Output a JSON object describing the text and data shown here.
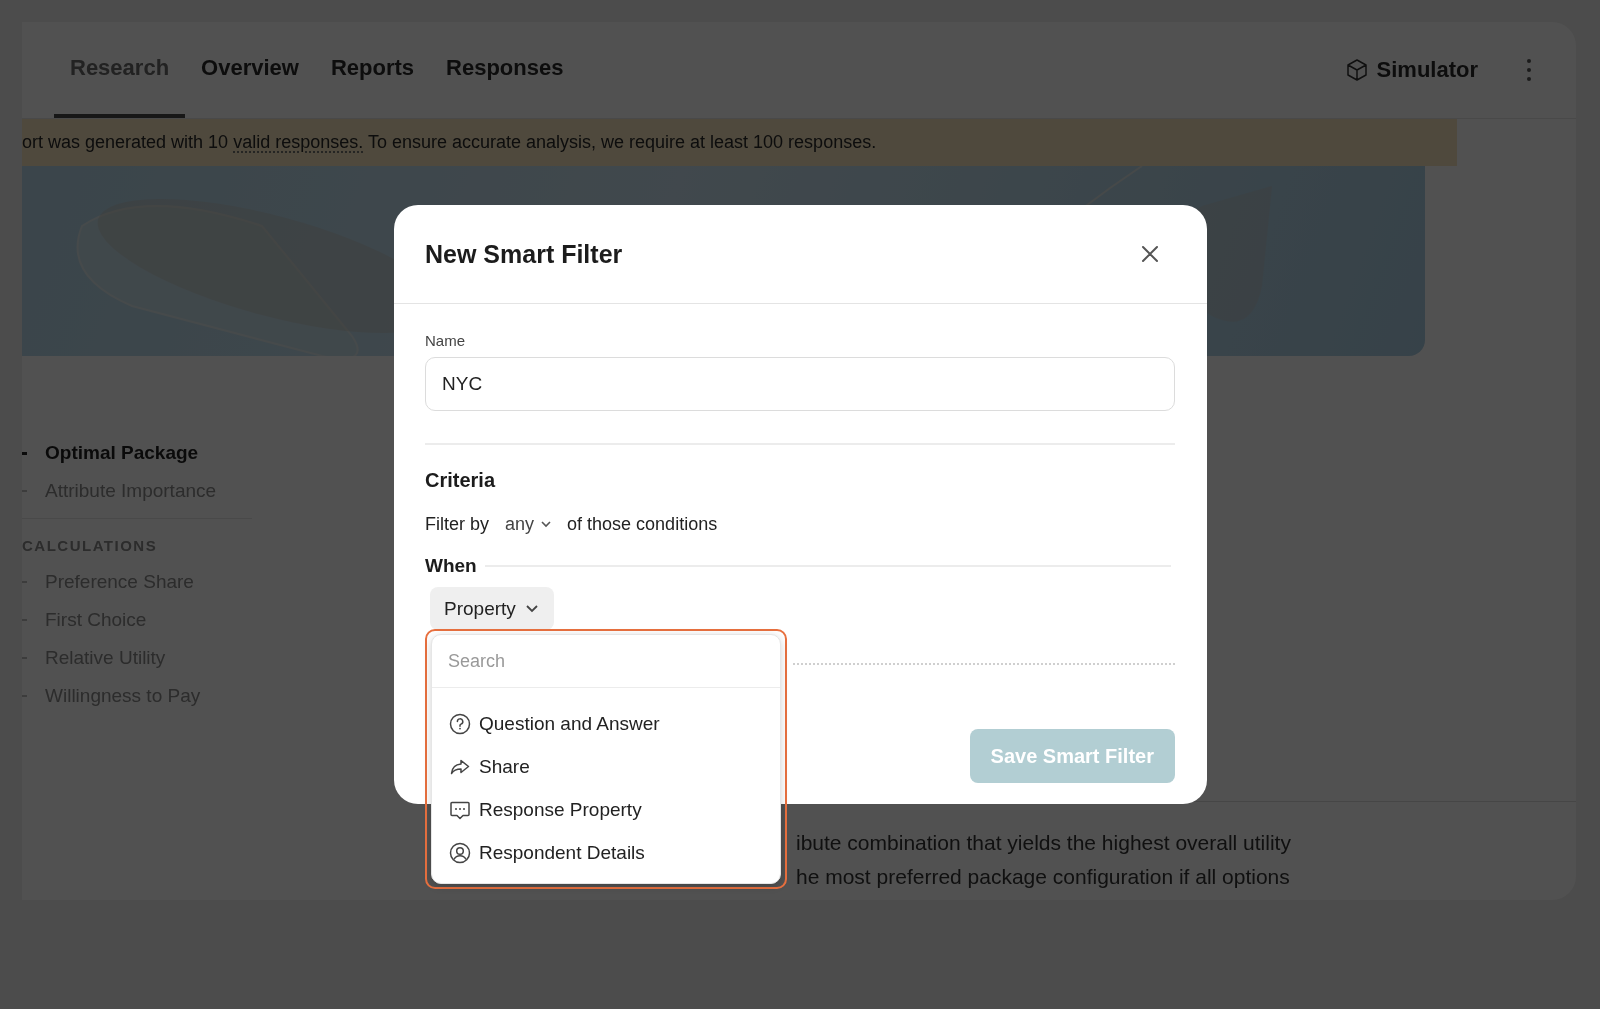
{
  "tabs": [
    {
      "label": "Research",
      "selected": true
    },
    {
      "label": "Overview",
      "selected": false
    },
    {
      "label": "Reports",
      "selected": false
    },
    {
      "label": "Responses",
      "selected": false
    }
  ],
  "simulator_button": {
    "label": "Simulator"
  },
  "notice": {
    "text_before": "ort was generated with 10 ",
    "link": "valid responses.",
    "text_after": " To ensure accurate analysis, we require at least 100 responses."
  },
  "sidebar": {
    "items": [
      {
        "label": "Optimal Package",
        "selected": true
      },
      {
        "label": "Attribute Importance",
        "selected": false
      }
    ],
    "section_title": "CALCULATIONS",
    "calculation_items": [
      {
        "label": "Preference Share",
        "selected": false
      },
      {
        "label": "First Choice",
        "selected": false
      },
      {
        "label": "Relative Utility",
        "selected": false
      },
      {
        "label": "Willingness to Pay",
        "selected": false
      }
    ]
  },
  "description": {
    "lines": [
      "ibute combination that yields the highest overall utility",
      "he most preferred package configuration if all options"
    ]
  },
  "modal": {
    "title": "New Smart Filter",
    "name_label": "Name",
    "name_value": "NYC",
    "criteria_title": "Criteria",
    "filter_prefix": "Filter by",
    "match_mode": "any",
    "filter_suffix": "of those conditions",
    "when_label": "When",
    "property_button": "Property",
    "save_button": {
      "label": "Save Smart Filter",
      "disabled": true
    }
  },
  "property_menu": {
    "search_placeholder": "Search",
    "options": [
      {
        "label": "Question and Answer",
        "kind": "question"
      },
      {
        "label": "Share",
        "kind": "share"
      },
      {
        "label": "Response Property",
        "kind": "chat"
      },
      {
        "label": "Respondent Details",
        "kind": "person"
      }
    ]
  }
}
